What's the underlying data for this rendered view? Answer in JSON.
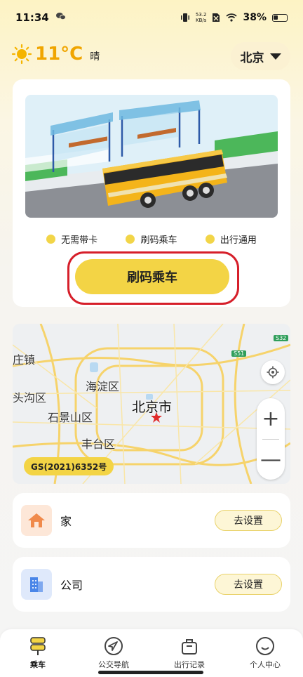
{
  "status_bar": {
    "time": "11:34",
    "net_speed_value": "53.2",
    "net_speed_unit": "KB/s",
    "battery": "38%"
  },
  "weather": {
    "temperature": "11°C",
    "condition": "晴",
    "icon": "sun-icon"
  },
  "city": {
    "label": "北京"
  },
  "ride_card": {
    "features": [
      "无需带卡",
      "刷码乘车",
      "出行通用"
    ],
    "ride_button": "刷码乘车"
  },
  "map": {
    "labels": {
      "village": "庄镇",
      "haidian": "海淀区",
      "mentougou": "头沟区",
      "shijingshan": "石景山区",
      "beijing": "北京市",
      "fengtai": "丰台区"
    },
    "road_tags": [
      "S51",
      "S32"
    ],
    "approval_no": "GS(2021)6352号",
    "zoom_in": "+",
    "zoom_out": "—"
  },
  "places": [
    {
      "name": "家",
      "action": "去设置",
      "icon": "home-icon"
    },
    {
      "name": "公司",
      "action": "去设置",
      "icon": "building-icon"
    }
  ],
  "tabbar": {
    "tabs": [
      {
        "label": "乘车",
        "icon": "bus-sign-icon",
        "active": true
      },
      {
        "label": "公交导航",
        "icon": "navigation-icon",
        "active": false
      },
      {
        "label": "出行记录",
        "icon": "luggage-icon",
        "active": false
      },
      {
        "label": "个人中心",
        "icon": "smile-icon",
        "active": false
      }
    ]
  },
  "colors": {
    "accent": "#f3d445",
    "highlight": "#d61f2a",
    "temperature": "#f0a500"
  }
}
